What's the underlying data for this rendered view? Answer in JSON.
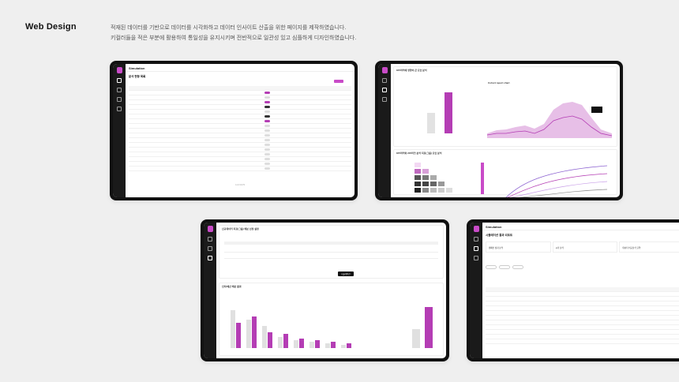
{
  "header": {
    "title": "Web Design",
    "desc_line1": "적재된 데이터를 기반으로 데이터를 시각화하고 데이터 인사이트 산출을 위한 페이지를 제작하였습니다.",
    "desc_line2": "키컬러들을 적은 부분에 활용하여 통일성을 유지시키며 전반적으로 일관성 있고 심플하게 디자인하였습니다."
  },
  "screens": {
    "s1": {
      "app": "Simulation",
      "page_title": "분석 현황 목록",
      "pager": "1 2 3 4 5"
    },
    "s2": {
      "card1": "KPI마커에 영향이 큰 요인 분석",
      "card2": "Cohort report chart",
      "card3": "KPI마커와 205마크 분석 지표(그룹) 요인 분석"
    },
    "s3": {
      "card1": "신규데이터 지표(그룹) 배분 선정 설정",
      "run": "시뮬레이션",
      "card2": "인지/예산 배분 결과"
    },
    "s4": {
      "app": "Simulation",
      "page_title": "시뮬레이션 결과 리포트",
      "t1": "캠페인 성과 분석",
      "t2": "시각 분석",
      "t3": "데이터 비교분석 요약"
    }
  },
  "colors": {
    "accent": "#c94bc8",
    "dark": "#111111"
  }
}
